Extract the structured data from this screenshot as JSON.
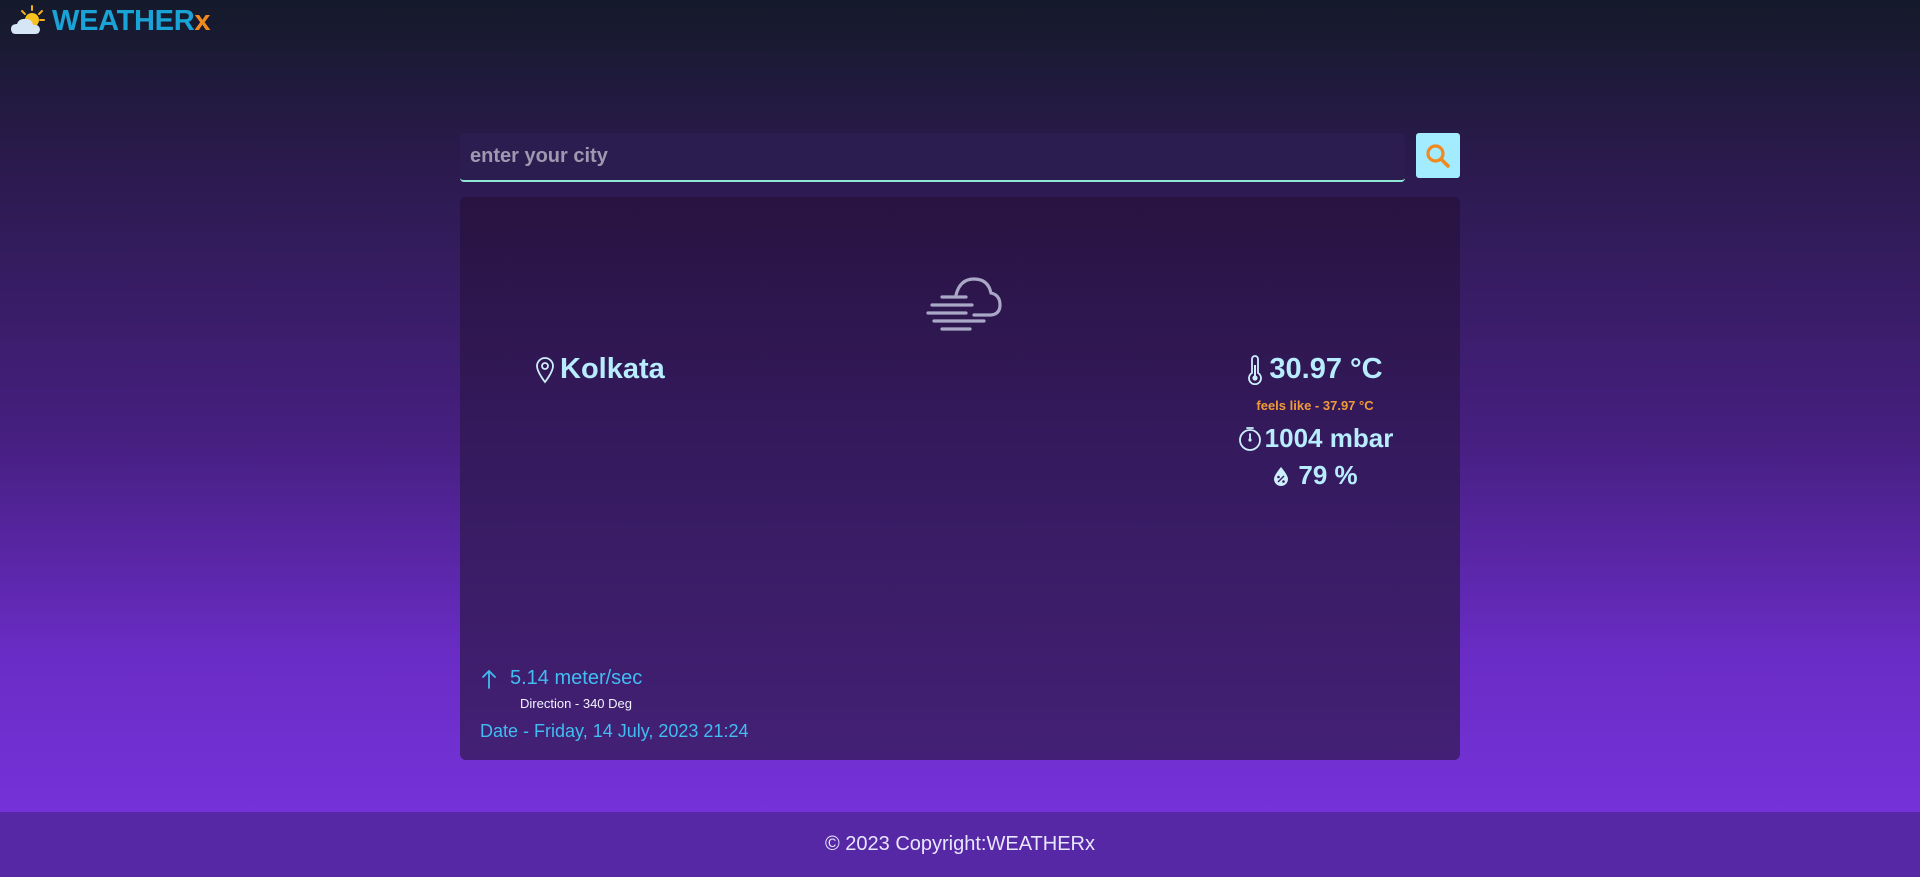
{
  "app": {
    "logo_text": "WEATHER",
    "logo_accent": "x",
    "logo_icon": "sun-cloud-icon"
  },
  "search": {
    "placeholder": "enter your city",
    "value": "",
    "button_icon": "search-icon"
  },
  "weather": {
    "condition_icon": "haze-cloud-icon",
    "city": "Kolkata",
    "temperature": "30.97 °C",
    "feels_like": "feels like - 37.97 °C",
    "pressure": "1004 mbar",
    "humidity": "79 %",
    "wind_speed": "5.14 meter/sec",
    "wind_direction": "Direction - 340 Deg",
    "date": "Date - Friday, 14 July, 2023 21:24"
  },
  "footer": {
    "copyright": "© 2023 Copyright:WEATHERx"
  },
  "colors": {
    "logo": "#1aa3d6",
    "logo_accent": "#f08a1e",
    "value_text": "#b8ecff",
    "feels_like": "#f29a3a",
    "wind_text": "#41bdf2",
    "search_button": "#a3ebff",
    "footer_bg": "#5628a6"
  }
}
